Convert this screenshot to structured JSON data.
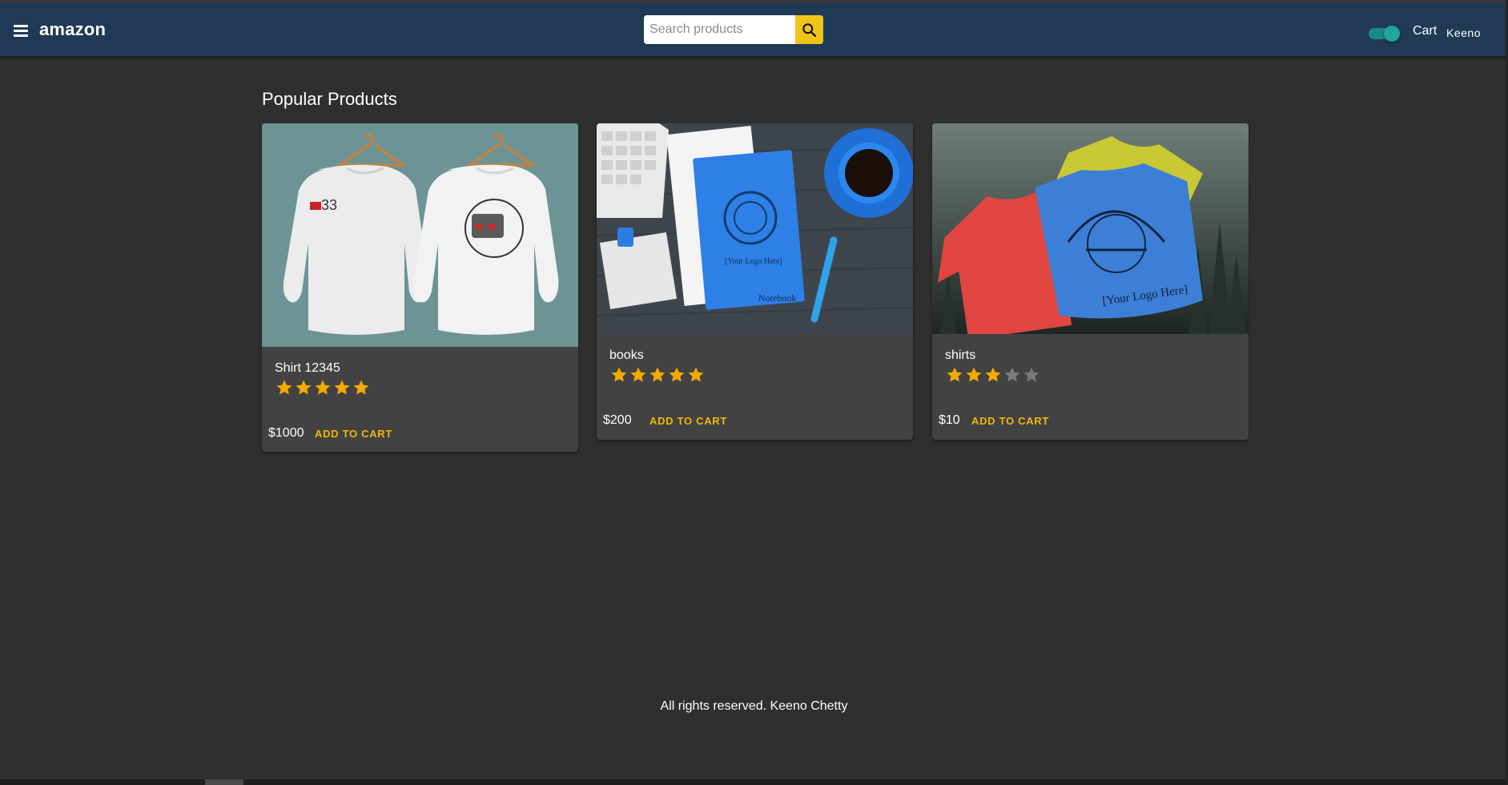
{
  "header": {
    "brand": "amazon",
    "search": {
      "placeholder": "Search products",
      "value": ""
    },
    "dark_mode_on": true,
    "cart_label": "Cart",
    "user_label": "Keeno"
  },
  "main": {
    "section_title": "Popular Products",
    "products": [
      {
        "name": "Shirt 12345",
        "rating": 5,
        "max_rating": 5,
        "price": "$1000",
        "action": "ADD TO CART"
      },
      {
        "name": "books",
        "rating": 5,
        "max_rating": 5,
        "price": "$200",
        "action": "ADD TO CART"
      },
      {
        "name": "shirts",
        "rating": 3,
        "max_rating": 5,
        "price": "$10",
        "action": "ADD TO CART"
      }
    ]
  },
  "footer": {
    "text": "All rights reserved. Keeno Chetty"
  },
  "colors": {
    "appbar": "#203a55",
    "background": "#2f2f2f",
    "card": "#424242",
    "accent": "#f2b705",
    "star_filled": "#f2a900",
    "star_empty": "#7a7a7a",
    "toggle": "#22a59c"
  },
  "icons": {
    "menu": "menu-icon",
    "search": "search-icon",
    "star": "star-icon"
  }
}
